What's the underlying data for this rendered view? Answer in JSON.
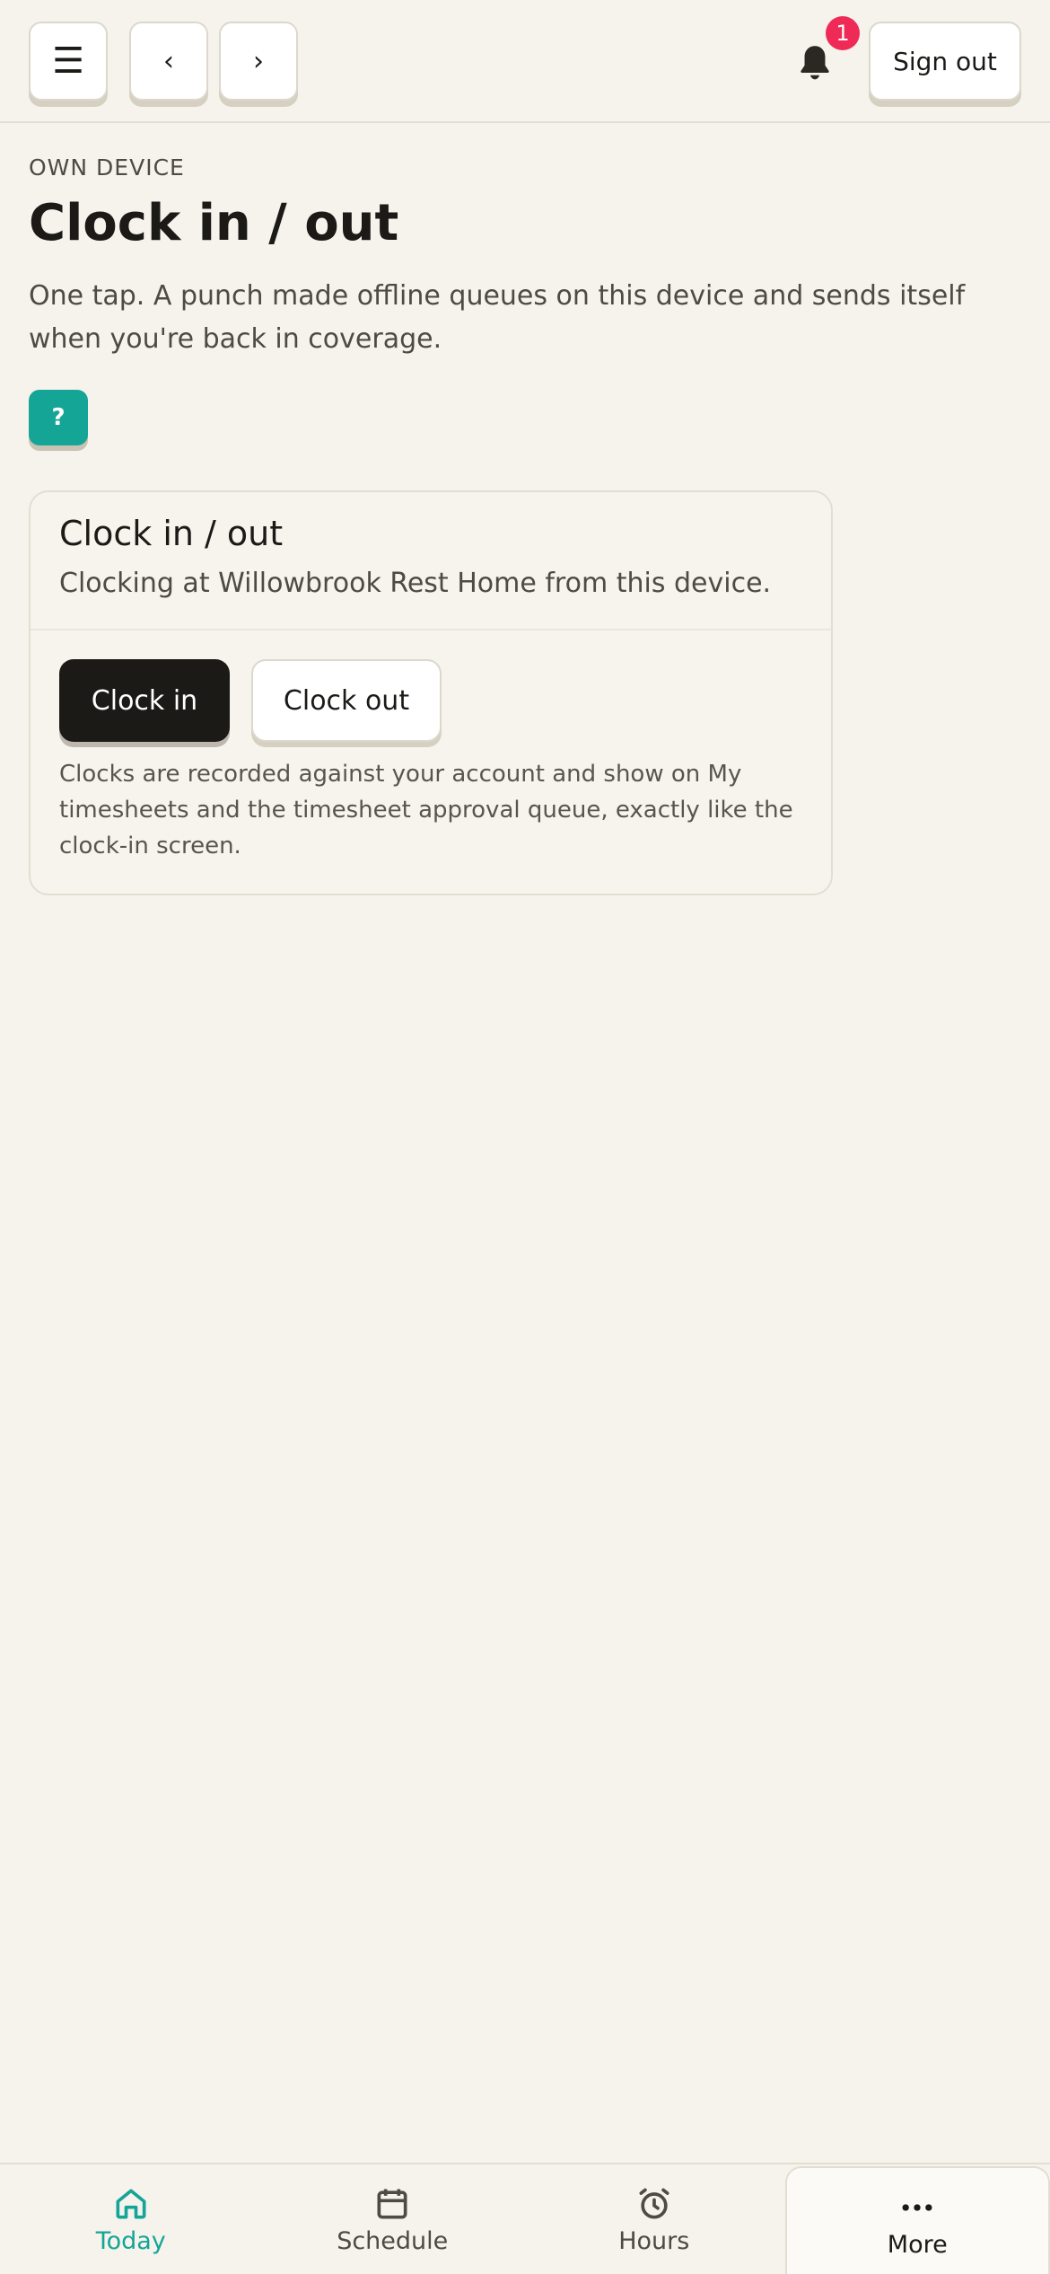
{
  "topbar": {
    "menu_glyph": "☰",
    "back_glyph": "‹",
    "forward_glyph": "›",
    "notification_count": "1",
    "sign_out_label": "Sign out"
  },
  "header": {
    "eyebrow": "OWN DEVICE",
    "title": "Clock in / out",
    "intro": "One tap. A punch made offline queues on this device and sends itself when you're back in coverage.",
    "help_label": "?"
  },
  "card": {
    "title": "Clock in / out",
    "subtitle": "Clocking at Willowbrook Rest Home from this device.",
    "clock_in_label": "Clock in",
    "clock_out_label": "Clock out",
    "note": "Clocks are recorded against your account and show on My timesheets and the timesheet approval queue, exactly like the clock-in screen."
  },
  "bottom_nav": {
    "items": [
      {
        "label": "Today",
        "icon": "home-icon",
        "active": true
      },
      {
        "label": "Schedule",
        "icon": "calendar-icon",
        "active": false
      },
      {
        "label": "Hours",
        "icon": "alarm-clock-icon",
        "active": false
      },
      {
        "label": "More",
        "icon": "more-dots-icon",
        "active": false
      }
    ]
  },
  "colors": {
    "background": "#f5f3ec",
    "accent": "#15a597",
    "badge": "#ef2a57",
    "primary_button": "#1c1a17"
  }
}
